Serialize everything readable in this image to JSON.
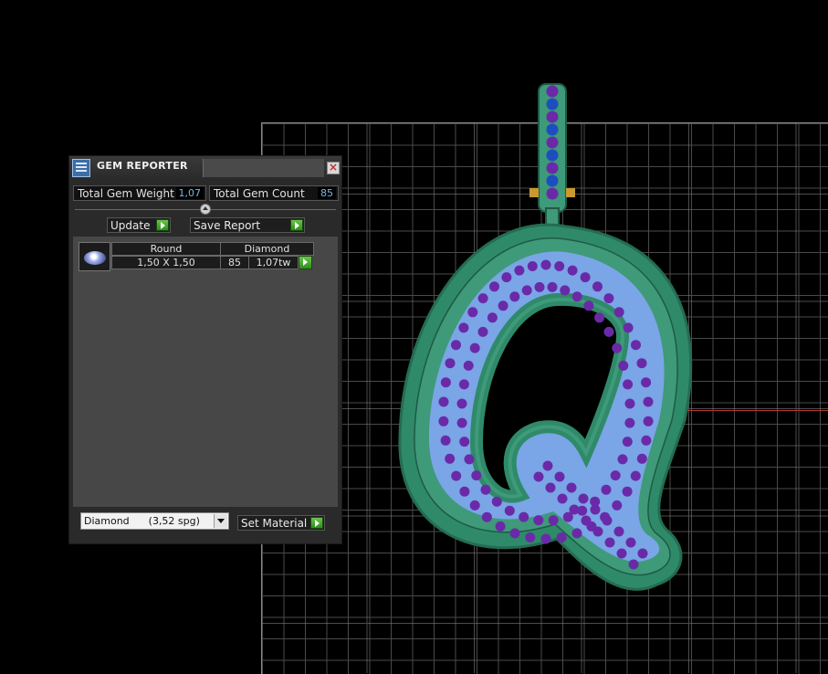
{
  "panel": {
    "title": "GEM REPORTER",
    "close_icon": "close-icon",
    "stats": {
      "weight_label": "Total Gem Weight",
      "weight_value": "1,07",
      "count_label": "Total Gem Count",
      "count_value": "85"
    },
    "buttons": {
      "update": "Update",
      "save_report": "Save Report",
      "set_material": "Set Material"
    },
    "gem_list": [
      {
        "shape": "Round",
        "material": "Diamond",
        "size": "1,50 X 1,50",
        "count": "85",
        "weight": "1,07tw"
      }
    ],
    "material_select": {
      "value": "Diamond      (3,52 spg)"
    }
  },
  "colors": {
    "metal": "#3e9a78",
    "gem_seat": "#7aa5e6",
    "gem_stone": "#6a2aa8",
    "bail_gem": "#1d4ebf",
    "accent_green": "#3fae2a",
    "axis_x": "#b43a2e",
    "axis_y": "#2e8fb4"
  }
}
